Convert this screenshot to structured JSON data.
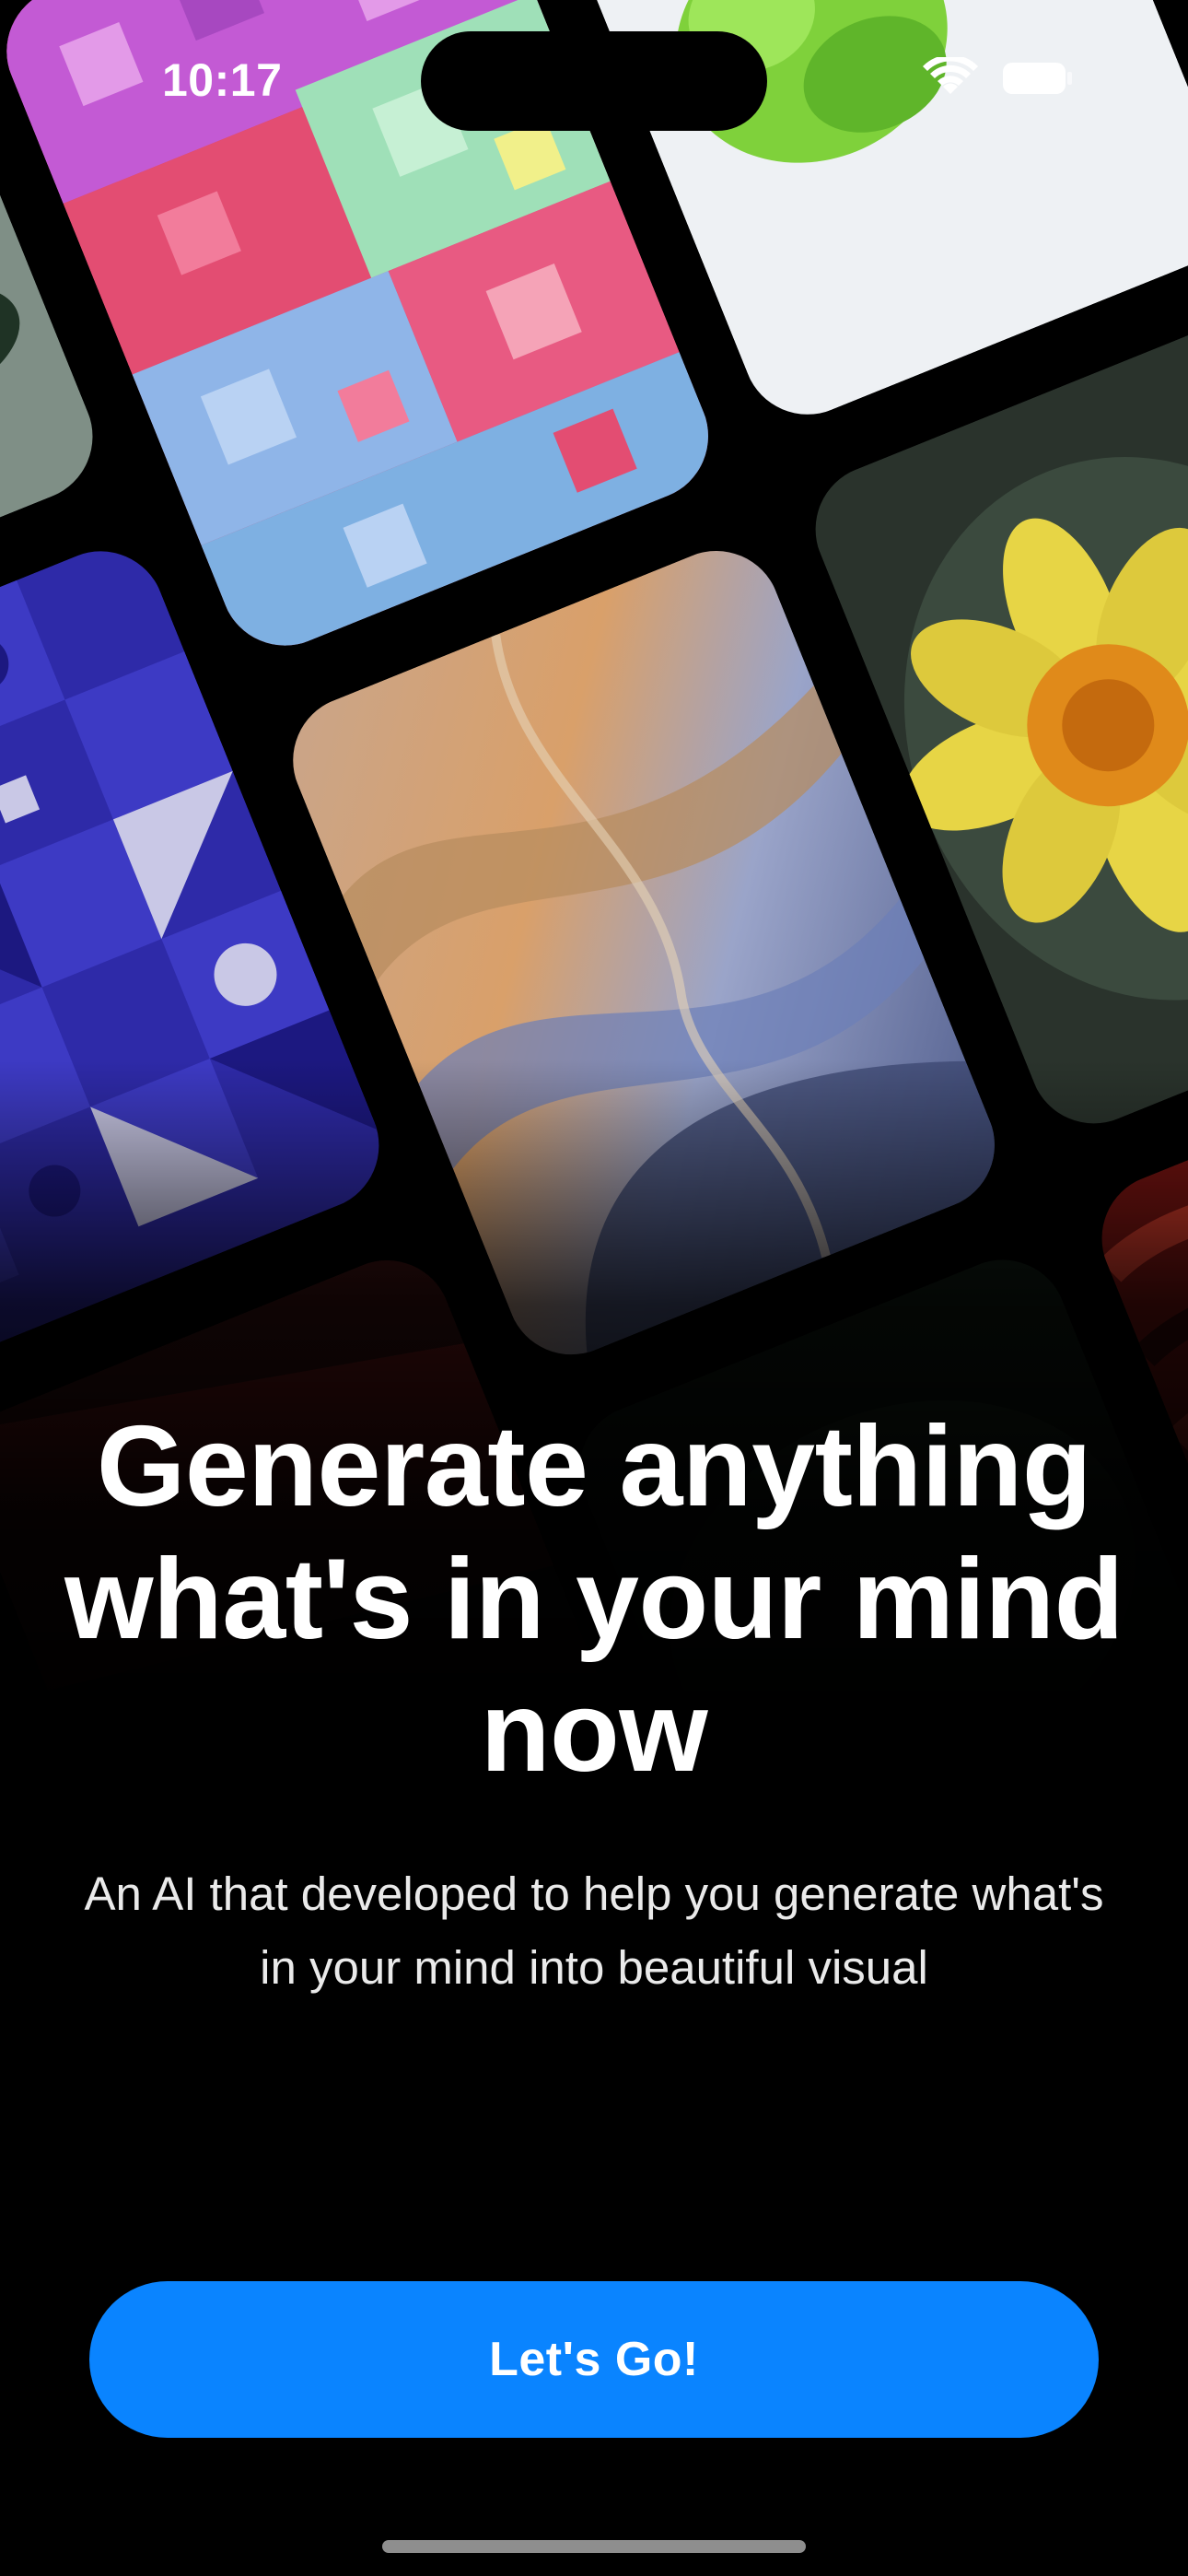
{
  "status_bar": {
    "time": "10:17"
  },
  "collage": {
    "tiles": [
      "cubes-artwork",
      "green-crystal-artwork",
      "plant-photo",
      "geometric-pattern-artwork",
      "marble-swirl-artwork",
      "yellow-flower-photo",
      "red-waves-artwork",
      "brick-wall-artwork",
      "dark-foliage-photo"
    ]
  },
  "onboarding": {
    "headline": "Generate anything what's in your mind now",
    "subtitle": "An AI that developed to help you generate what's in your mind into beautiful visual"
  },
  "cta": {
    "label": "Let's Go!"
  },
  "colors": {
    "accent": "#0A84FF",
    "background": "#000000"
  }
}
